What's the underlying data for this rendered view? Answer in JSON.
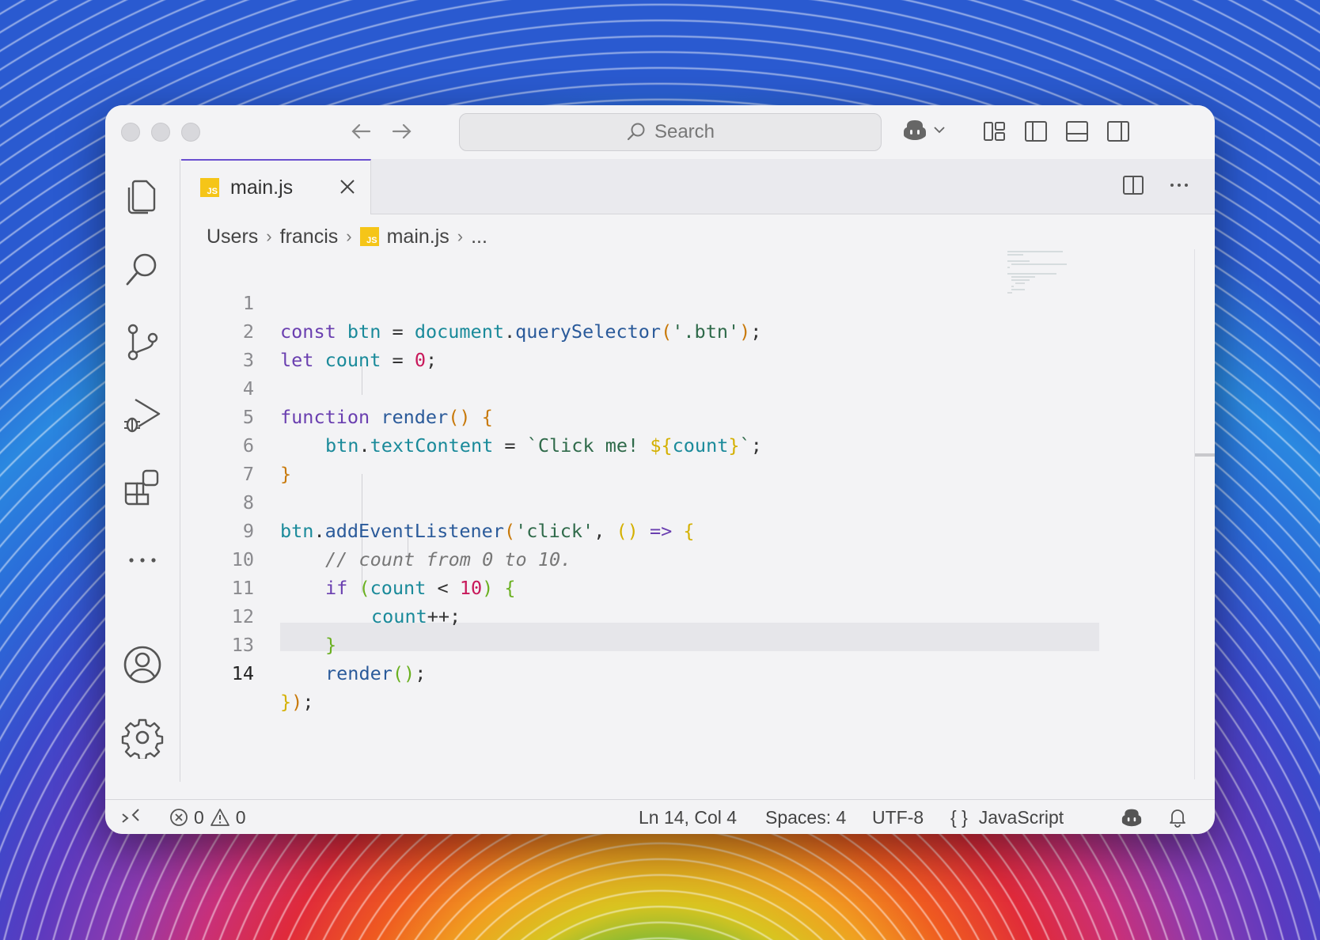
{
  "window": {
    "search_placeholder": "Search"
  },
  "tab": {
    "file_name": "main.js",
    "icon_label": "JS"
  },
  "breadcrumb": {
    "items": [
      "Users",
      "francis",
      "main.js",
      "..."
    ]
  },
  "editor": {
    "line_numbers": [
      "1",
      "2",
      "3",
      "4",
      "5",
      "6",
      "7",
      "8",
      "9",
      "10",
      "11",
      "12",
      "13",
      "14"
    ],
    "current_line": 14
  },
  "code": {
    "l1": [
      "const",
      " ",
      "btn",
      " = ",
      "document",
      ".",
      "querySelector",
      "(",
      "'.btn'",
      ")",
      ";"
    ],
    "l2": [
      "let",
      " ",
      "count",
      " = ",
      "0",
      ";"
    ],
    "l4": [
      "function",
      " ",
      "render",
      "()",
      " ",
      "{"
    ],
    "l5": [
      "btn",
      ".",
      "textContent",
      " = ",
      "`Click me! ",
      "${",
      "count",
      "}",
      "`",
      ";"
    ],
    "l6": [
      "}"
    ],
    "l8": [
      "btn",
      ".",
      "addEventListener",
      "(",
      "'click'",
      ", ",
      "()",
      " ",
      "=>",
      " ",
      "{"
    ],
    "l9": [
      "// count from 0 to 10."
    ],
    "l10": [
      "if",
      " ",
      "(",
      "count",
      " < ",
      "10",
      ")",
      " ",
      "{"
    ],
    "l11": [
      "count",
      "++;"
    ],
    "l12": [
      "}"
    ],
    "l13": [
      "render",
      "()",
      ";"
    ],
    "l14": [
      "}",
      ")",
      ";"
    ]
  },
  "status": {
    "errors": "0",
    "warnings": "0",
    "position": "Ln 14, Col 4",
    "spaces": "Spaces: 4",
    "encoding": "UTF-8",
    "language_icon": "{ }",
    "language": "JavaScript"
  },
  "colors": {
    "tab_accent": "#6a4fd0",
    "js_badge": "#f5c518"
  }
}
